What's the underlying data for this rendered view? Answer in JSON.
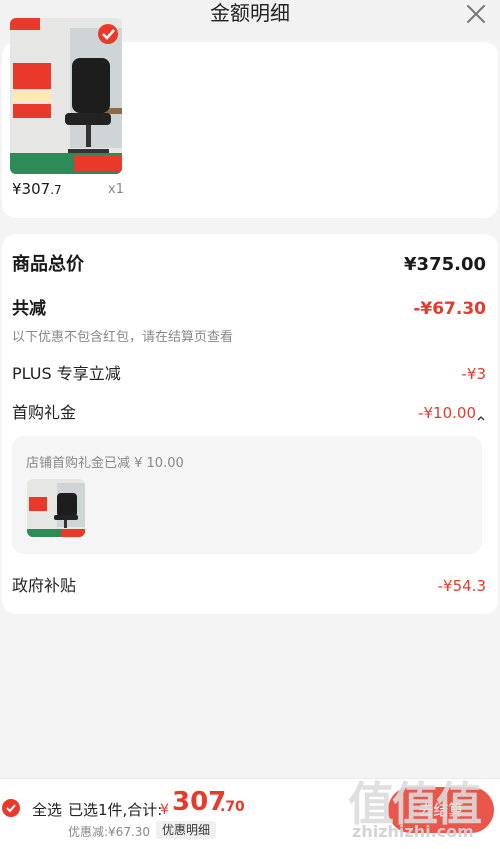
{
  "header": {
    "title": "金额明细",
    "close_icon": "close-icon"
  },
  "product": {
    "price_integer": "¥307",
    "price_decimal": ".7",
    "quantity": "x1",
    "image_icon": "office-chair-product-image"
  },
  "breakdown": {
    "total_label": "商品总价",
    "total_amount": "¥375.00",
    "reduce_label": "共减",
    "reduce_amount": "-¥67.30",
    "reduce_note": "以下优惠不包含红包，请在结算页查看",
    "plus_label": "PLUS 专享立减",
    "plus_amount": "-¥3",
    "gift_label": "首购礼金",
    "gift_amount": "-¥10.00",
    "gift_detail": "店铺首购礼金已减 ¥ 10.00",
    "gov_label": "政府补贴",
    "gov_amount": "-¥54.3"
  },
  "bottom_bar": {
    "select_all": "全选",
    "selected_summary": "已选1件,合计:",
    "total_currency": "¥",
    "total_integer": "307",
    "total_decimal": ".70",
    "discount_text": "优惠减:¥67.30",
    "detail_button": "优惠明细",
    "settle_button": "去结算"
  },
  "watermark": {
    "logo": "值值值",
    "url": "zhizhizhi.com"
  },
  "colors": {
    "accent": "#e8392b",
    "muted": "#888888"
  }
}
